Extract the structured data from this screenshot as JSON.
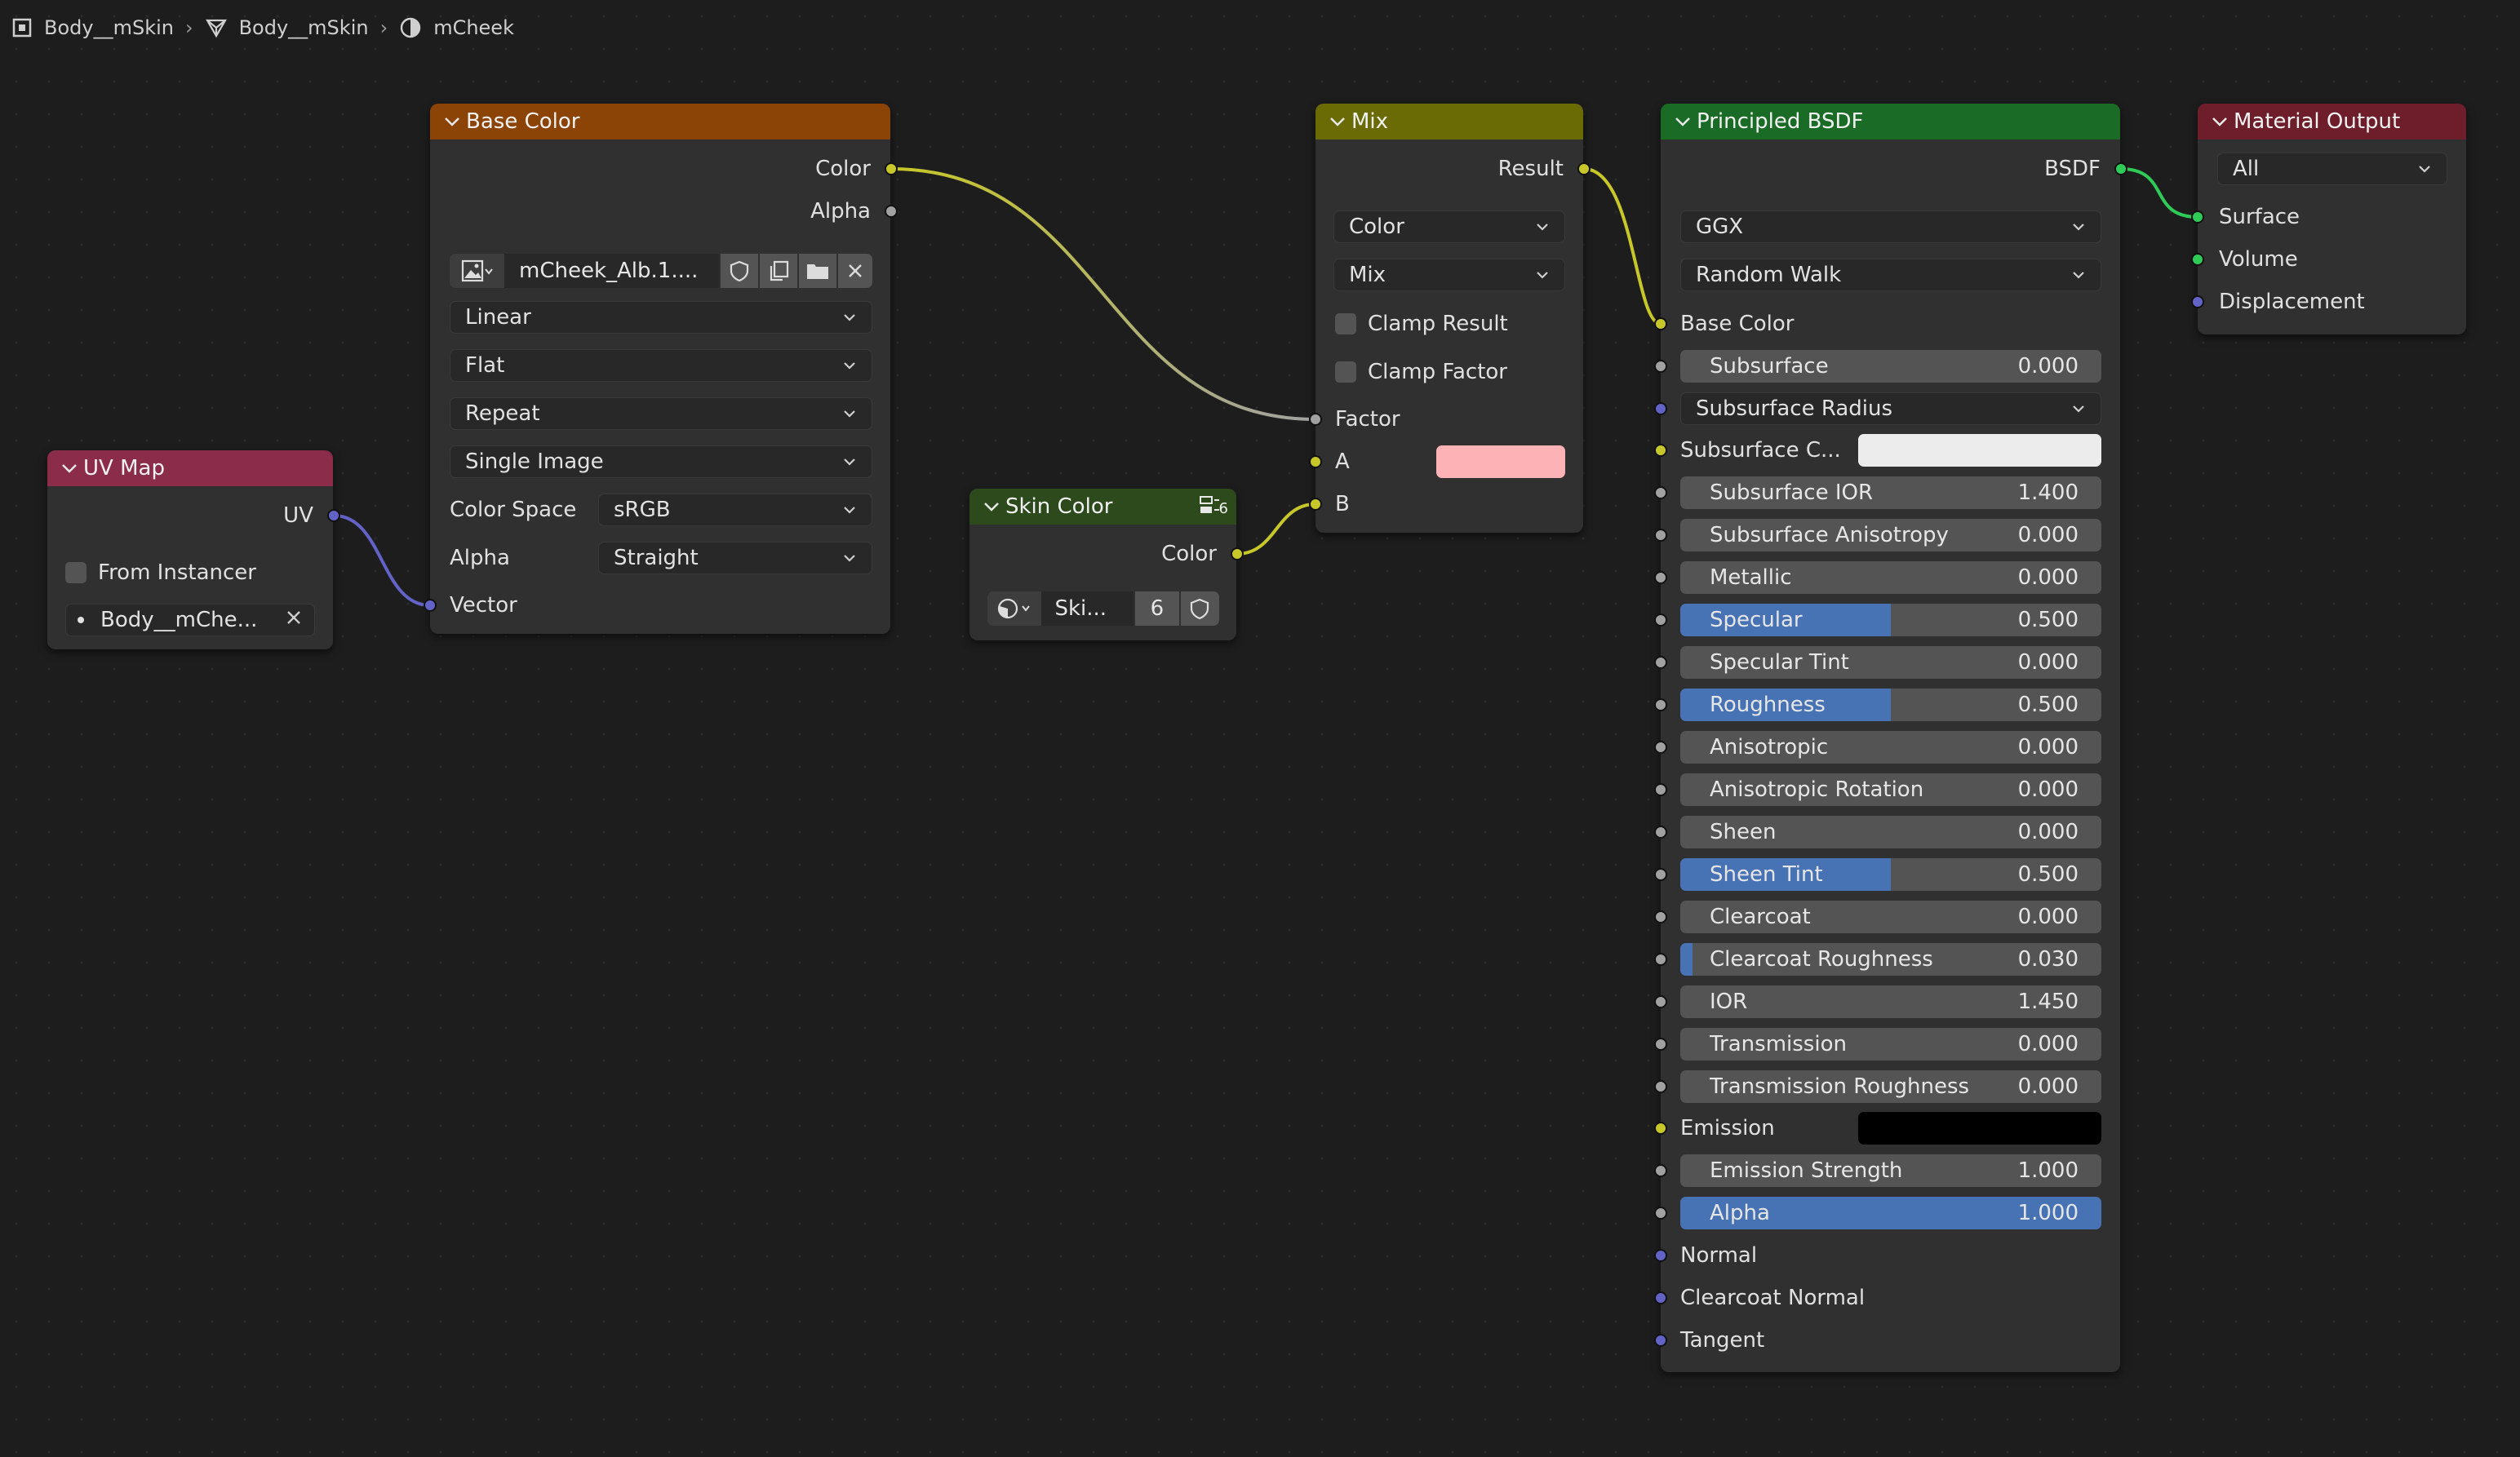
{
  "breadcrumb": {
    "items": [
      "Body__mSkin",
      "Body__mSkin",
      "mCheek"
    ]
  },
  "colors": {
    "canvas": "#1d1d1d",
    "node_body": "#303030",
    "header_texture": "#8b4306",
    "header_input": "#8b2c4a",
    "header_converter": "#6b6b06",
    "header_shader": "#1a6b25",
    "header_group": "#2c4a1c",
    "header_output": "#6e1e2b",
    "socket_color": "#c7c729",
    "socket_float": "#a1a1a1",
    "socket_vector": "#6363c7",
    "socket_shader": "#2ecb57",
    "field_fill": "#4772b3",
    "mix_a_color": "#fdb3b6",
    "subsurface_color": "#ececec",
    "emission_color": "#000000"
  },
  "uv_map": {
    "title": "UV Map",
    "out_uv": "UV",
    "from_instancer": "From Instancer",
    "map_name": "Body__mChe..."
  },
  "base_color": {
    "title": "Base Color",
    "out_color": "Color",
    "out_alpha": "Alpha",
    "image_name": "mCheek_Alb.1....",
    "interpolation": "Linear",
    "projection": "Flat",
    "extension": "Repeat",
    "source": "Single Image",
    "color_space_label": "Color Space",
    "color_space": "sRGB",
    "alpha_label": "Alpha",
    "alpha_mode": "Straight",
    "in_vector": "Vector"
  },
  "skin_color": {
    "title": "Skin Color",
    "users_badge": "6",
    "out_color": "Color",
    "group_name": "Ski...",
    "users": "6"
  },
  "mix": {
    "title": "Mix",
    "out_result": "Result",
    "data_type": "Color",
    "blend_mode": "Mix",
    "clamp_result": "Clamp Result",
    "clamp_factor": "Clamp Factor",
    "in_factor": "Factor",
    "in_a": "A",
    "in_b": "B"
  },
  "bsdf": {
    "title": "Principled BSDF",
    "out_bsdf": "BSDF",
    "distribution": "GGX",
    "subsurface_method": "Random Walk",
    "base_color": "Base Color",
    "subsurface_radius": "Subsurface Radius",
    "subsurface_color": "Subsurface C...",
    "emission": "Emission",
    "normal": "Normal",
    "clearcoat_normal": "Clearcoat Normal",
    "tangent": "Tangent",
    "fields": [
      {
        "label": "Subsurface",
        "value": "0.000",
        "fill": 0.0
      },
      {
        "label": "Subsurface IOR",
        "value": "1.400",
        "fill": 0.0
      },
      {
        "label": "Subsurface Anisotropy",
        "value": "0.000",
        "fill": 0.0
      },
      {
        "label": "Metallic",
        "value": "0.000",
        "fill": 0.0
      },
      {
        "label": "Specular",
        "value": "0.500",
        "fill": 0.5
      },
      {
        "label": "Specular Tint",
        "value": "0.000",
        "fill": 0.0
      },
      {
        "label": "Roughness",
        "value": "0.500",
        "fill": 0.5
      },
      {
        "label": "Anisotropic",
        "value": "0.000",
        "fill": 0.0
      },
      {
        "label": "Anisotropic Rotation",
        "value": "0.000",
        "fill": 0.0
      },
      {
        "label": "Sheen",
        "value": "0.000",
        "fill": 0.0
      },
      {
        "label": "Sheen Tint",
        "value": "0.500",
        "fill": 0.5
      },
      {
        "label": "Clearcoat",
        "value": "0.000",
        "fill": 0.0
      },
      {
        "label": "Clearcoat Roughness",
        "value": "0.030",
        "fill": 0.03
      },
      {
        "label": "IOR",
        "value": "1.450",
        "fill": 0.0
      },
      {
        "label": "Transmission",
        "value": "0.000",
        "fill": 0.0
      },
      {
        "label": "Transmission Roughness",
        "value": "0.000",
        "fill": 0.0
      },
      {
        "label": "Emission Strength",
        "value": "1.000",
        "fill": 0.0
      },
      {
        "label": "Alpha",
        "value": "1.000",
        "fill": 1.0
      }
    ]
  },
  "material_output": {
    "title": "Material Output",
    "target": "All",
    "in_surface": "Surface",
    "in_volume": "Volume",
    "in_displacement": "Displacement"
  }
}
